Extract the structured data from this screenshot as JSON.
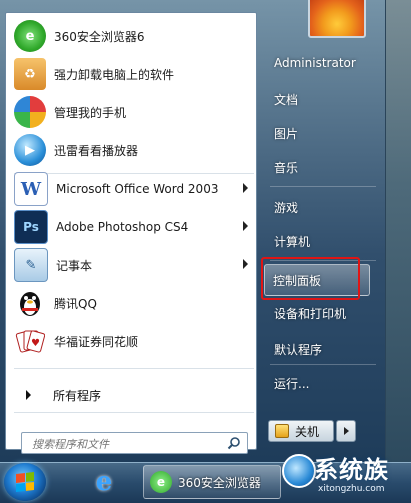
{
  "pinned": [
    {
      "label": "360安全浏览器6",
      "icon": "browser-360-icon"
    },
    {
      "label": "强力卸载电脑上的软件",
      "icon": "uninstall-box-icon"
    },
    {
      "label": "管理我的手机",
      "icon": "phone-manager-icon"
    },
    {
      "label": "迅雷看看播放器",
      "icon": "xunlei-player-icon"
    }
  ],
  "recent": [
    {
      "label": "Microsoft Office Word 2003",
      "icon": "word-icon",
      "has_submenu": true
    },
    {
      "label": "Adobe Photoshop CS4",
      "icon": "photoshop-icon",
      "has_submenu": true
    },
    {
      "label": "记事本",
      "icon": "notepad-icon",
      "has_submenu": true
    },
    {
      "label": "腾讯QQ",
      "icon": "qq-penguin-icon",
      "has_submenu": false
    },
    {
      "label": "华福证券同花顺",
      "icon": "cards-icon",
      "has_submenu": false
    }
  ],
  "all_programs": "所有程序",
  "search_placeholder": "搜索程序和文件",
  "right_items": [
    "Administrator",
    "文档",
    "图片",
    "音乐",
    "游戏",
    "计算机",
    "控制面板",
    "设备和打印机",
    "默认程序",
    "运行..."
  ],
  "shutdown_label": "关机",
  "taskbar": {
    "active_app_label": "360安全浏览器"
  },
  "watermark": {
    "main": "系统族",
    "sub": "xitongzhu.com"
  },
  "colors": {
    "highlight_box": "#e01515",
    "word_blue": "#2b5fb4",
    "photoshop_navy": "#0f2e55"
  }
}
